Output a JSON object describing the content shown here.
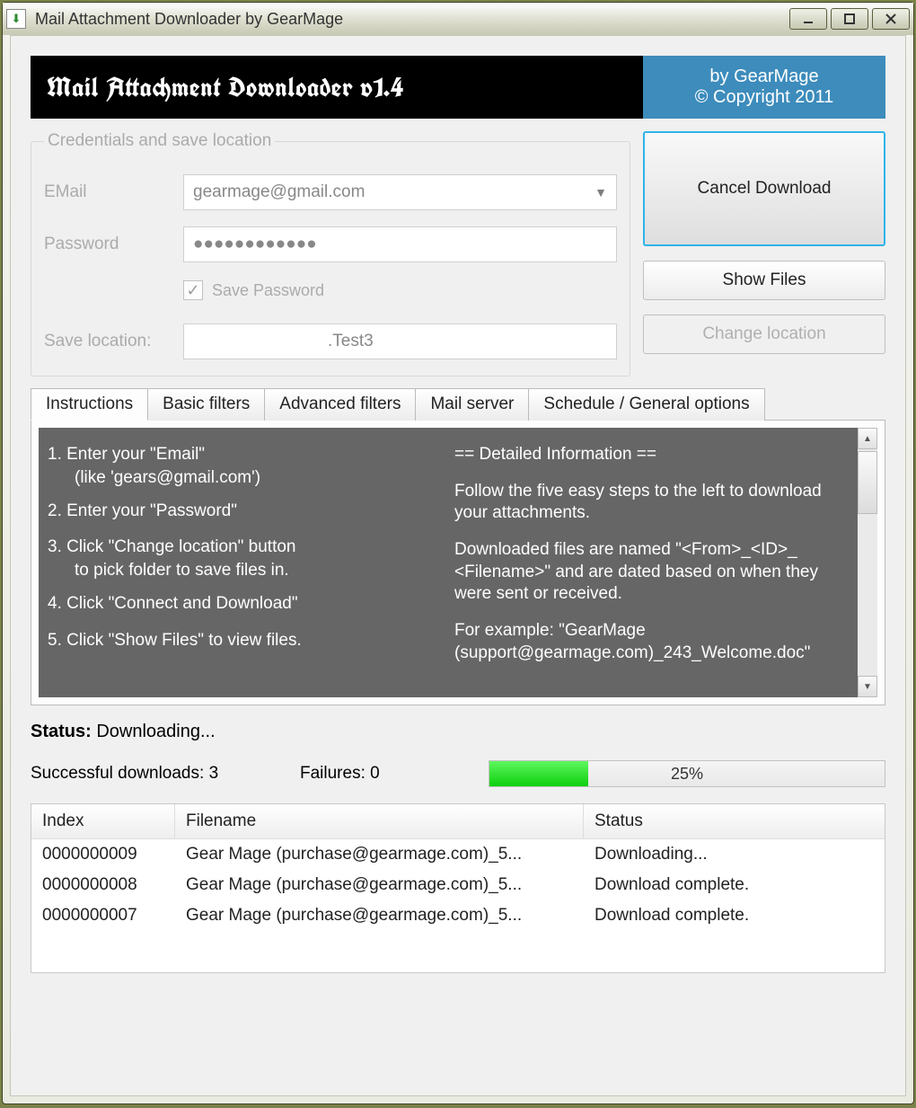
{
  "window": {
    "title": "Mail Attachment Downloader by GearMage"
  },
  "banner": {
    "title": "Mail Attachment Downloader v1.4",
    "by": "by GearMage",
    "copyright": "© Copyright 2011"
  },
  "group": {
    "legend": "Credentials and save location",
    "email_label": "EMail",
    "email_value": "gearmage@gmail.com",
    "password_label": "Password",
    "password_value": "●●●●●●●●●●●●",
    "save_password_label": "Save Password",
    "save_location_label": "Save location:",
    "save_location_value": ".Test3"
  },
  "buttons": {
    "cancel": "Cancel Download",
    "show_files": "Show Files",
    "change_location": "Change location"
  },
  "tabs": {
    "instructions": "Instructions",
    "basic": "Basic filters",
    "advanced": "Advanced filters",
    "mail_server": "Mail server",
    "schedule": "Schedule / General options"
  },
  "instructions": {
    "s1": "1. Enter your \"Email\"",
    "s1b": "(like 'gears@gmail.com')",
    "s2": "2. Enter your \"Password\"",
    "s3": "3. Click \"Change location\" button",
    "s3b": "to pick folder to save files in.",
    "s4": "4. Click \"Connect and Download\"",
    "s5": "5. Click \"Show Files\" to view files.",
    "detail_head": "== Detailed Information ==",
    "detail_p1": "Follow the five easy steps to the left to download your attachments.",
    "detail_p2": "Downloaded files are named \"<From>_<ID>_ <Filename>\" and are dated based on when they were sent or received.",
    "detail_p3": "For example: \"GearMage (support@gearmage.com)_243_Welcome.doc\""
  },
  "status": {
    "label": "Status:",
    "value": "Downloading...",
    "success_label": "Successful downloads:",
    "success_count": "3",
    "fail_label": "Failures:",
    "fail_count": "0",
    "progress_pct": "25%"
  },
  "table": {
    "col_index": "Index",
    "col_filename": "Filename",
    "col_status": "Status",
    "rows": [
      {
        "index": "0000000009",
        "filename": "Gear Mage  (purchase@gearmage.com)_5...",
        "status": "Downloading..."
      },
      {
        "index": "0000000008",
        "filename": "Gear Mage  (purchase@gearmage.com)_5...",
        "status": "Download complete."
      },
      {
        "index": "0000000007",
        "filename": "Gear Mage  (purchase@gearmage.com)_5...",
        "status": "Download complete."
      }
    ]
  }
}
